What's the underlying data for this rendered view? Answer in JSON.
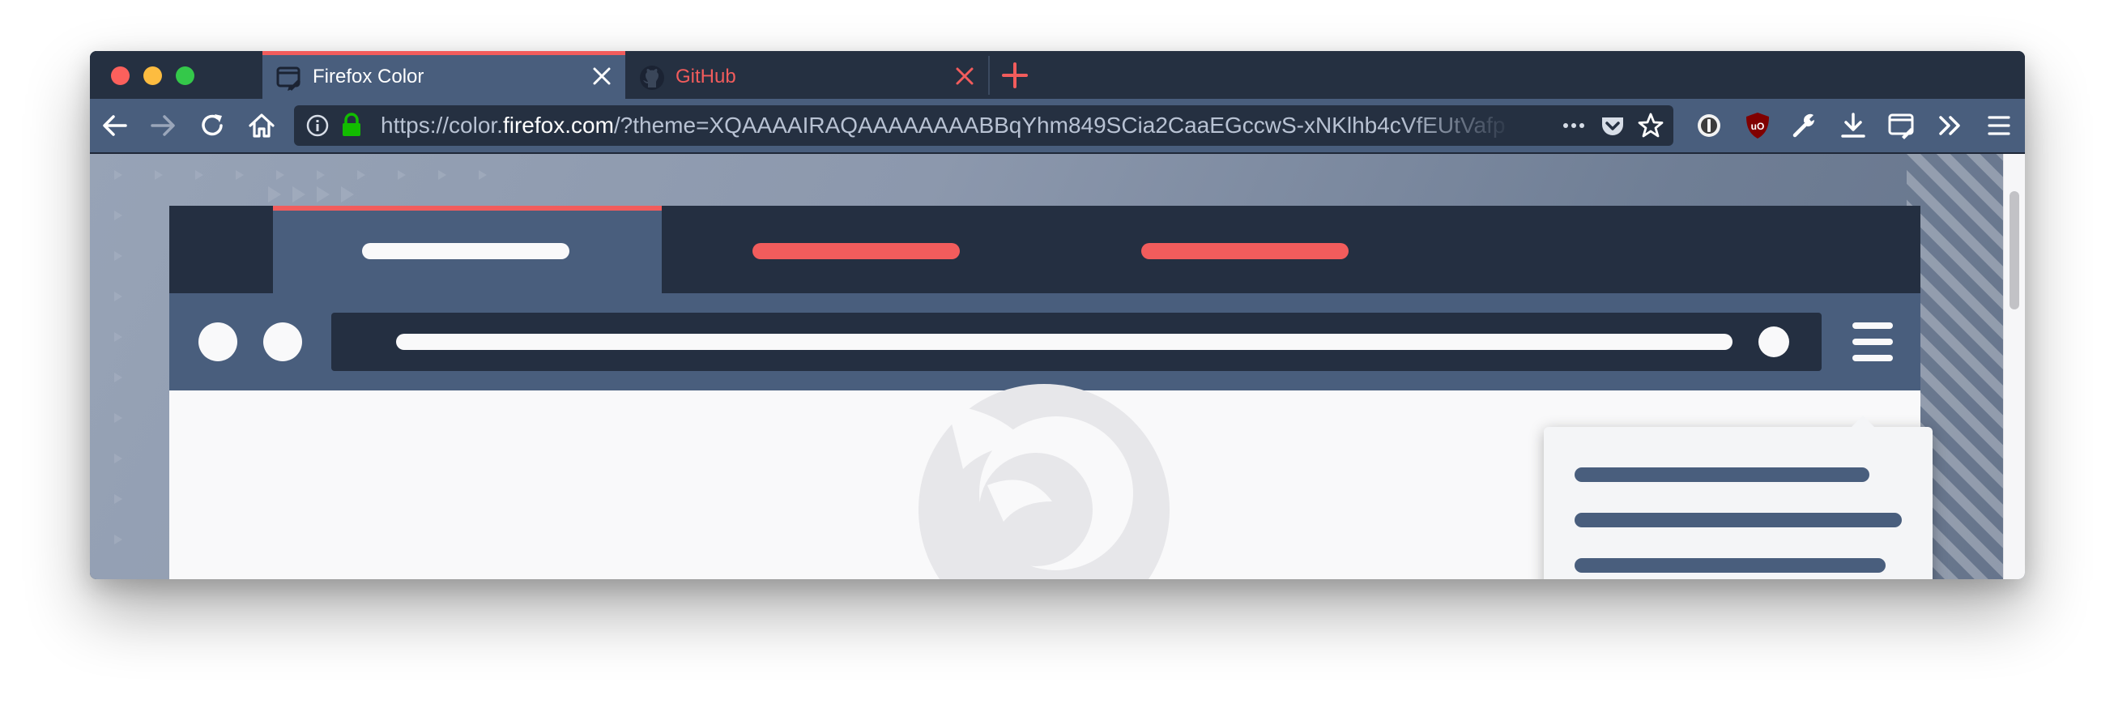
{
  "window": {
    "tabs": [
      {
        "title": "Firefox Color",
        "active": true,
        "icon": "firefox-color-icon"
      },
      {
        "title": "GitHub",
        "active": false,
        "icon": "github-icon"
      }
    ],
    "new_tab_icon": "plus-icon"
  },
  "toolbar": {
    "url": {
      "prefix": "https://color.",
      "host": "firefox.com",
      "suffix": "/?theme=XQAAAAIRAQAAAAAAAABBqYhm849SCia2CaaEGccwS-xNKlhb4cVfEUtVafp"
    },
    "buttons": [
      "back-icon",
      "forward-icon",
      "reload-icon",
      "home-icon",
      "info-icon",
      "lock-icon",
      "more-icon",
      "pocket-icon",
      "bookmark-star-icon",
      "onepassword-icon",
      "ublock-icon",
      "wrench-icon",
      "download-icon",
      "firefox-color-icon",
      "overflow-icon",
      "hamburger-menu-icon"
    ],
    "ublock_label": "uO"
  },
  "colors": {
    "frame": "#242f41",
    "toolbar": "#495e7d",
    "accent": "#f25c5c",
    "text": "#ffffff",
    "popup": "#f4f5f7"
  }
}
